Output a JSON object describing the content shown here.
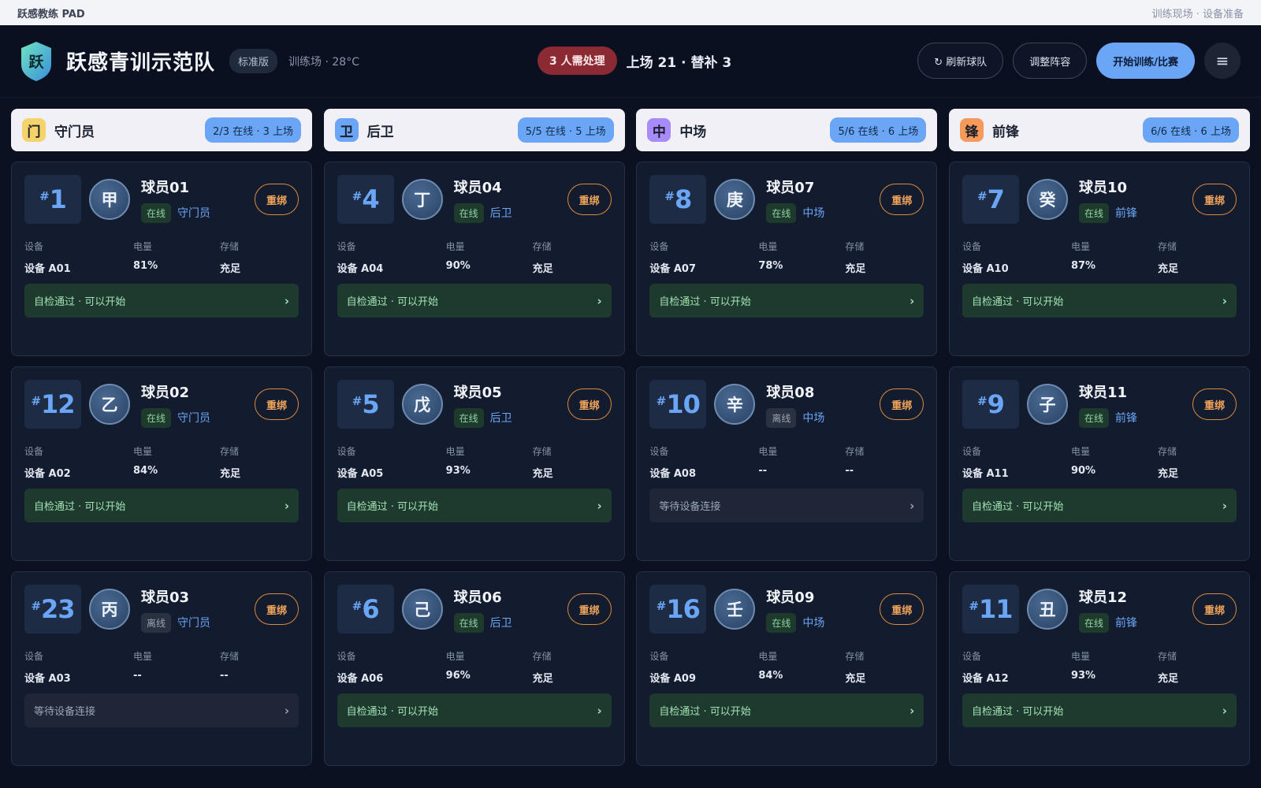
{
  "topbar": {
    "app_name": "跃感教练 PAD",
    "breadcrumb": "训练现场 · 设备准备"
  },
  "header": {
    "logo_char": "跃",
    "team_name": "跃感青训示范队",
    "edition": "标准版",
    "venue": "训练场 · 28°C",
    "alert": "3 人需处理",
    "lineup": "上场 21 · 替补 3",
    "refresh_label": "↻ 刷新球队",
    "adjust_label": "调整阵容",
    "start_label": "开始训练/比赛",
    "menu_icon": "≡"
  },
  "labels": {
    "device": "设备",
    "battery": "电量",
    "storage": "存储",
    "rebind": "重绑",
    "hash": "#"
  },
  "colors": {
    "accent": "#6aa6f5",
    "gk": "#f5d36b",
    "df": "#6aa6f5",
    "mf": "#a78bfa",
    "fw": "#f59a5b"
  },
  "columns": [
    {
      "icon": "门",
      "title": "守门员",
      "stat": "2/3 在线 · 3 上场",
      "players": [
        {
          "number": "1",
          "avatar": "甲",
          "name": "球员01",
          "status": "在线",
          "position": "守门员",
          "device": "设备 A01",
          "battery": "81%",
          "storage": "充足",
          "check": "自检通过 · 可以开始",
          "ok": true
        },
        {
          "number": "12",
          "avatar": "乙",
          "name": "球员02",
          "status": "在线",
          "position": "守门员",
          "device": "设备 A02",
          "battery": "84%",
          "storage": "充足",
          "check": "自检通过 · 可以开始",
          "ok": true
        },
        {
          "number": "23",
          "avatar": "丙",
          "name": "球员03",
          "status": "离线",
          "position": "守门员",
          "device": "设备 A03",
          "battery": "--",
          "storage": "--",
          "check": "等待设备连接",
          "ok": false
        }
      ]
    },
    {
      "icon": "卫",
      "title": "后卫",
      "stat": "5/5 在线 · 5 上场",
      "players": [
        {
          "number": "4",
          "avatar": "丁",
          "name": "球员04",
          "status": "在线",
          "position": "后卫",
          "device": "设备 A04",
          "battery": "90%",
          "storage": "充足",
          "check": "自检通过 · 可以开始",
          "ok": true
        },
        {
          "number": "5",
          "avatar": "戊",
          "name": "球员05",
          "status": "在线",
          "position": "后卫",
          "device": "设备 A05",
          "battery": "93%",
          "storage": "充足",
          "check": "自检通过 · 可以开始",
          "ok": true
        },
        {
          "number": "6",
          "avatar": "己",
          "name": "球员06",
          "status": "在线",
          "position": "后卫",
          "device": "设备 A06",
          "battery": "96%",
          "storage": "充足",
          "check": "自检通过 · 可以开始",
          "ok": true
        }
      ]
    },
    {
      "icon": "中",
      "title": "中场",
      "stat": "5/6 在线 · 6 上场",
      "players": [
        {
          "number": "8",
          "avatar": "庚",
          "name": "球员07",
          "status": "在线",
          "position": "中场",
          "device": "设备 A07",
          "battery": "78%",
          "storage": "充足",
          "check": "自检通过 · 可以开始",
          "ok": true
        },
        {
          "number": "10",
          "avatar": "辛",
          "name": "球员08",
          "status": "离线",
          "position": "中场",
          "device": "设备 A08",
          "battery": "--",
          "storage": "--",
          "check": "等待设备连接",
          "ok": false
        },
        {
          "number": "16",
          "avatar": "壬",
          "name": "球员09",
          "status": "在线",
          "position": "中场",
          "device": "设备 A09",
          "battery": "84%",
          "storage": "充足",
          "check": "自检通过 · 可以开始",
          "ok": true
        }
      ]
    },
    {
      "icon": "锋",
      "title": "前锋",
      "stat": "6/6 在线 · 6 上场",
      "players": [
        {
          "number": "7",
          "avatar": "癸",
          "name": "球员10",
          "status": "在线",
          "position": "前锋",
          "device": "设备 A10",
          "battery": "87%",
          "storage": "充足",
          "check": "自检通过 · 可以开始",
          "ok": true
        },
        {
          "number": "9",
          "avatar": "子",
          "name": "球员11",
          "status": "在线",
          "position": "前锋",
          "device": "设备 A11",
          "battery": "90%",
          "storage": "充足",
          "check": "自检通过 · 可以开始",
          "ok": true
        },
        {
          "number": "11",
          "avatar": "丑",
          "name": "球员12",
          "status": "在线",
          "position": "前锋",
          "device": "设备 A12",
          "battery": "93%",
          "storage": "充足",
          "check": "自检通过 · 可以开始",
          "ok": true
        }
      ]
    }
  ]
}
